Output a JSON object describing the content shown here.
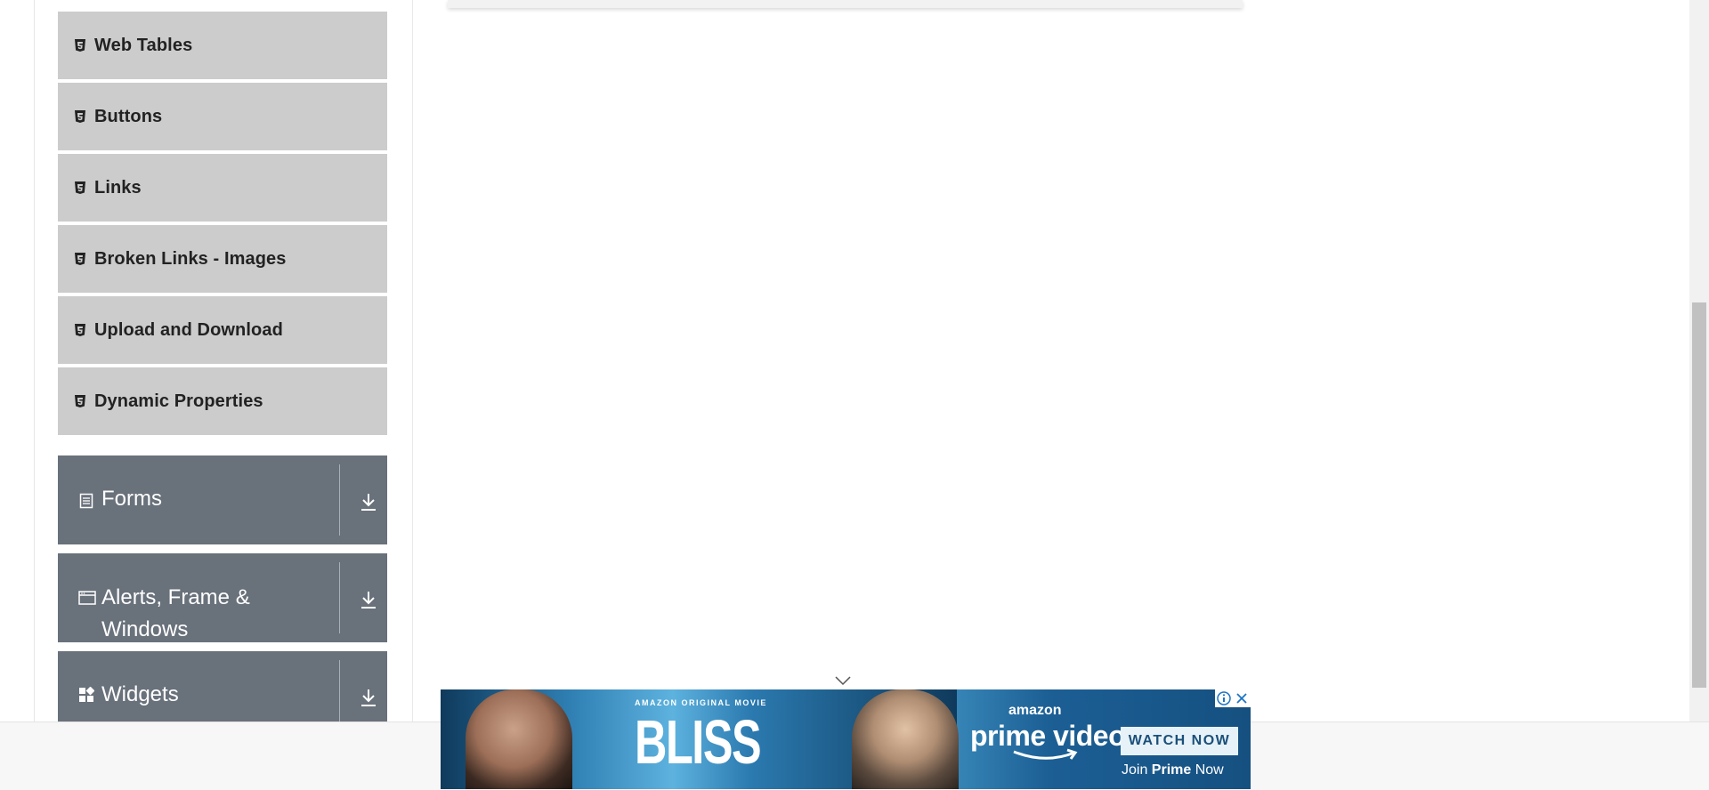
{
  "sidebar": {
    "elements_items": [
      {
        "label": "Web Tables",
        "icon": "html5-icon"
      },
      {
        "label": "Buttons",
        "icon": "html5-icon"
      },
      {
        "label": "Links",
        "icon": "html5-icon"
      },
      {
        "label": "Broken Links - Images",
        "icon": "html5-icon"
      },
      {
        "label": "Upload and Download",
        "icon": "html5-icon"
      },
      {
        "label": "Dynamic Properties",
        "icon": "html5-icon"
      }
    ],
    "groups": [
      {
        "title": "Forms",
        "icon": "form-icon"
      },
      {
        "title": "Alerts, Frame & Windows",
        "icon": "window-icon"
      },
      {
        "title": "Widgets",
        "icon": "widgets-icon"
      }
    ]
  },
  "ad": {
    "tagline": "AMAZON ORIGINAL MOVIE",
    "title": "BLISS",
    "brand_top": "amazon",
    "brand_main": "prime video",
    "cta": "WATCH NOW",
    "join_prefix": "Join ",
    "join_bold": "Prime",
    "join_suffix": " Now"
  },
  "colors": {
    "item_bg": "#cccccc",
    "group_bg": "#69717b",
    "ad_bg": "#2a78ad"
  }
}
